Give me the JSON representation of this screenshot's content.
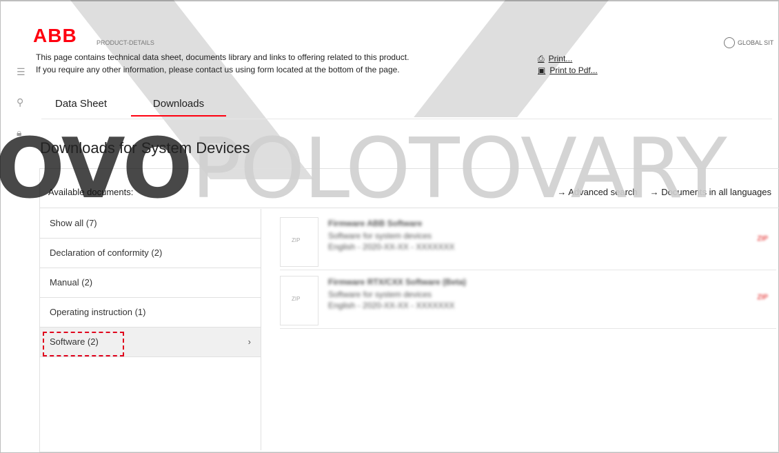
{
  "brand": {
    "logo": "ABB",
    "breadcrumb": "PRODUCT-DETAILS",
    "global_site": "GLOBAL SIT"
  },
  "info": {
    "line1": "This page contains technical data sheet, documents library and links to offering related to this product.",
    "line2": "If you require any other information, please contact us using form located at the bottom of the page.",
    "print": "Print...",
    "print_pdf": "Print to Pdf..."
  },
  "sidebar_icons": [
    "menu-icon",
    "search-icon",
    "lock-icon"
  ],
  "tabs": [
    {
      "label": "Data Sheet",
      "active": false
    },
    {
      "label": "Downloads",
      "active": true
    }
  ],
  "heading": "Downloads for System Devices",
  "watermark": "OVOPOLOTOVARY",
  "documents": {
    "available_label": "Available documents:",
    "advanced_search": "→ Advanced search",
    "all_languages": "→ Documents in all languages",
    "categories": [
      {
        "label": "Show all (7)"
      },
      {
        "label": "Declaration of conformity (2)"
      },
      {
        "label": "Manual (2)"
      },
      {
        "label": "Operating instruction (1)"
      },
      {
        "label": "Software (2)",
        "active": true,
        "highlighted": true
      }
    ],
    "items": [
      {
        "title": "Firmware ABB Software",
        "line2": "Software for system devices",
        "line3": "English - 2020-XX-XX - XXXXXXX",
        "thumb_text": "ZIP",
        "format": "ZIP"
      },
      {
        "title": "Firmware RTX/CXX Software (Beta)",
        "line2": "Software for system devices",
        "line3": "English - 2020-XX-XX - XXXXXXX",
        "thumb_text": "ZIP",
        "format": "ZIP"
      }
    ]
  },
  "colors": {
    "accent": "#ff000f",
    "highlight_dash": "#e0001b"
  }
}
